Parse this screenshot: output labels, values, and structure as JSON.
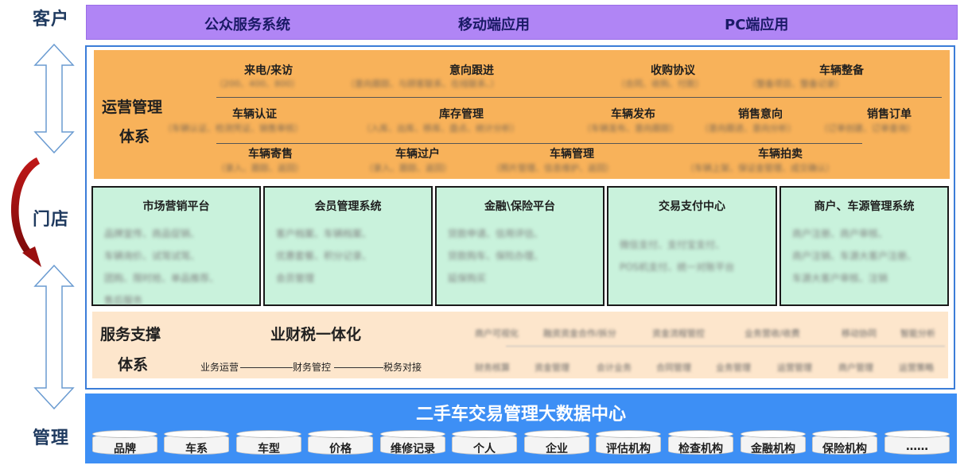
{
  "side_labels": {
    "customer": "客户",
    "store": "门店",
    "management": "管理"
  },
  "top_bar": [
    "公众服务系统",
    "移动端应用",
    "PC端应用"
  ],
  "ops": {
    "title_line1": "运营管理",
    "title_line2": "体系",
    "row1": [
      {
        "title": "来电/来访",
        "desc": "（200、400、800）"
      },
      {
        "title": "意向跟进",
        "desc": "（意向跟踪、与顾客联系、在线联系、）"
      },
      {
        "title": "收购协议",
        "desc": "（合同、收购、付款）"
      },
      {
        "title": "车辆整备",
        "desc": "（整备项目、整备记录）"
      }
    ],
    "row2": [
      {
        "title": "车辆认证",
        "desc": "（车辆认证、检测凭证、销售审核）"
      },
      {
        "title": "库存管理",
        "desc": "（入库、出库、移库、盘点、统计分析）"
      },
      {
        "title": "车辆发布",
        "desc": "（车辆发布、意向跟踪）"
      },
      {
        "title": "销售意向",
        "desc": "（意向跟进、意向分析）"
      },
      {
        "title": "销售订单",
        "desc": "（订单创建、订单查询）"
      }
    ],
    "row3": [
      {
        "title": "车辆寄售",
        "desc": "（录入、跟踪、返回）"
      },
      {
        "title": "车辆过户",
        "desc": "（录入、跟踪、返回）"
      },
      {
        "title": "车辆管理",
        "desc": "（照片管理、信息维护、返回）"
      },
      {
        "title": "车辆拍卖",
        "desc": "（车辆上架、保证金管理、成交确认）"
      }
    ]
  },
  "platforms": [
    {
      "title": "市场营销平台",
      "lines": [
        "品牌宣传、商品促销、",
        "车辆询价、试驾试驾、",
        "团购、限时抢、单品推荐、",
        "售后服务"
      ]
    },
    {
      "title": "会员管理系统",
      "lines": [
        "客户档案、车辆档案、",
        "优惠套餐、积分记录、",
        "会员管理"
      ]
    },
    {
      "title": "金融\\保险平台",
      "lines": [
        "贷款申请、信用评估、",
        "贷款购车、保险办理、",
        "延保购买"
      ]
    },
    {
      "title": "交易支付中心",
      "lines": [
        "微信支付、支付宝支付、",
        "POS机支付、统一对账平台"
      ]
    },
    {
      "title": "商户、车源管理系统",
      "lines": [
        "商户注册、商户审核、",
        "商户注销、车源大客户注册、",
        "车源大客户审核、注销"
      ]
    }
  ],
  "service": {
    "title_line1": "服务支撑",
    "title_line2": "体系",
    "integration": "业财税一体化",
    "flow": [
      "业务运营",
      "财务管控",
      "税务对接"
    ],
    "grid_row1": [
      "商户可视化",
      "融资资金合作/拆分",
      "资金流程管控",
      "业务营收/收费",
      "移动协同",
      "智能分析"
    ],
    "grid_row2": [
      "财务核算",
      "资金管理",
      "会计业务",
      "合同管理",
      "业务管理",
      "运营管理",
      "商户管理",
      "运营策略"
    ]
  },
  "data_center": {
    "title": "二手车交易管理大数据中心",
    "items": [
      "品牌",
      "车系",
      "车型",
      "价格",
      "维修记录",
      "个人",
      "企业",
      "评估机构",
      "检查机构",
      "金融机构",
      "保险机构",
      "……"
    ]
  }
}
